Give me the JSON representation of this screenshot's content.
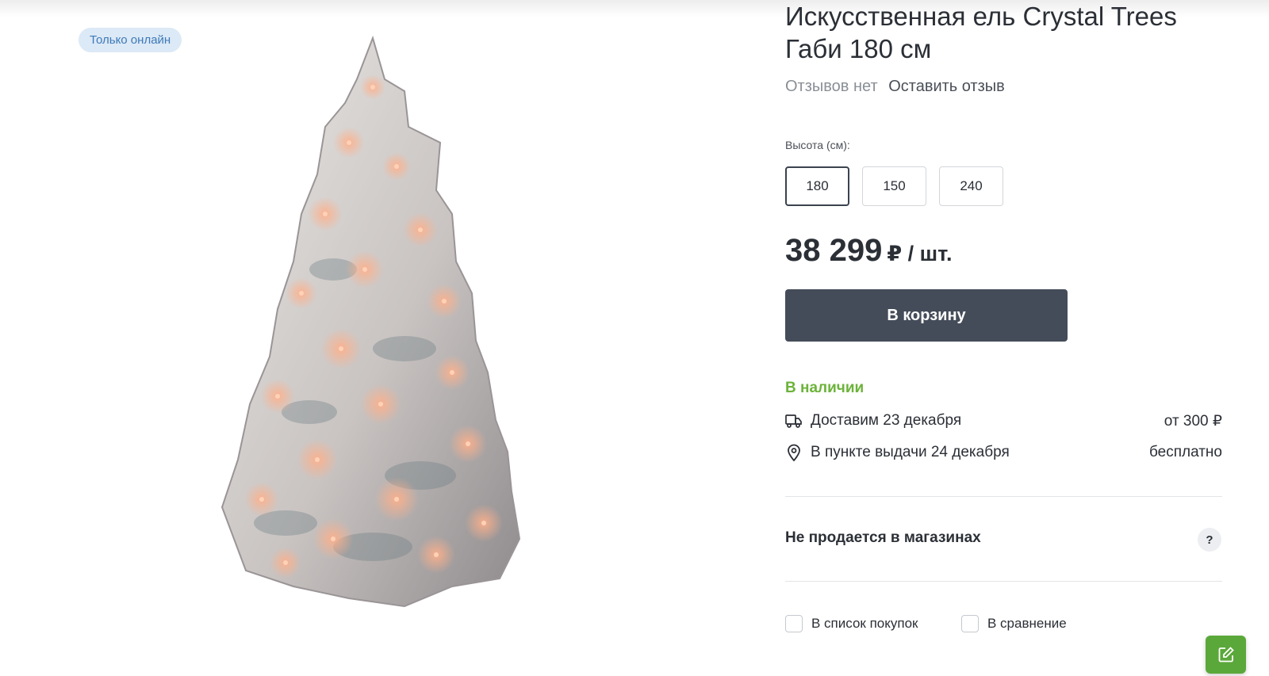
{
  "badge": {
    "label": "Только онлайн"
  },
  "product": {
    "title": "Искусственная ель Crystal Trees Габи 180 см",
    "image_icon": "christmas-tree-photo"
  },
  "reviews": {
    "none_label": "Отзывов нет",
    "leave_label": "Оставить отзыв"
  },
  "options": {
    "label": "Высота (см):",
    "sizes": [
      "180",
      "150",
      "240"
    ],
    "selected": "180"
  },
  "price": {
    "amount": "38 299",
    "unit": "₽ / шт."
  },
  "cart": {
    "button_label": "В корзину"
  },
  "availability": {
    "status": "В наличии",
    "color": "#6cb33a"
  },
  "delivery": [
    {
      "icon": "truck-icon",
      "text": "Доставим 23 декабря",
      "cost": "от 300 ₽"
    },
    {
      "icon": "map-pin-icon",
      "text": "В пункте выдачи 24 декабря",
      "cost": "бесплатно"
    }
  ],
  "stores": {
    "label": "Не продается в магазинах",
    "help": "?"
  },
  "checkboxes": [
    {
      "label": "В список покупок",
      "checked": false
    },
    {
      "label": "В сравнение",
      "checked": false
    }
  ],
  "fab": {
    "icon": "edit-icon",
    "color": "#5ba83a"
  },
  "colors": {
    "button_bg": "#454c59",
    "badge_bg": "#dce9f6",
    "badge_text": "#3d7ab8"
  }
}
